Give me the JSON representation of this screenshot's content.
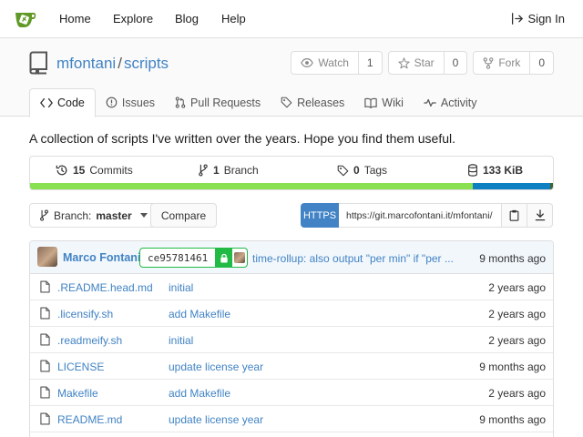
{
  "nav": {
    "items": [
      {
        "label": "Home"
      },
      {
        "label": "Explore"
      },
      {
        "label": "Blog"
      },
      {
        "label": "Help"
      }
    ],
    "signin": "Sign In"
  },
  "repo": {
    "owner": "mfontani",
    "separator": "/",
    "name": "scripts",
    "watch": {
      "label": "Watch",
      "count": "1"
    },
    "star": {
      "label": "Star",
      "count": "0"
    },
    "fork": {
      "label": "Fork",
      "count": "0"
    }
  },
  "tabs": [
    {
      "label": "Code",
      "icon": "code-icon"
    },
    {
      "label": "Issues",
      "icon": "issue-icon"
    },
    {
      "label": "Pull Requests",
      "icon": "pull-request-icon"
    },
    {
      "label": "Releases",
      "icon": "tag-icon"
    },
    {
      "label": "Wiki",
      "icon": "book-icon"
    },
    {
      "label": "Activity",
      "icon": "pulse-icon"
    }
  ],
  "description": "A collection of scripts I've written over the years. Hope you find them useful.",
  "stats": {
    "commits_count": "15",
    "commits_label": "Commits",
    "branches_count": "1",
    "branches_label": "Branch",
    "tags_count": "0",
    "tags_label": "Tags",
    "size": "133 KiB"
  },
  "languages": [
    {
      "share": 0.847,
      "color": "#89e051"
    },
    {
      "share": 0.147,
      "color": "#0e7fc0"
    },
    {
      "share": 0.006,
      "color": "#3e6630"
    }
  ],
  "branch": {
    "prefix": "Branch:",
    "name": "master"
  },
  "compare_label": "Compare",
  "clone": {
    "protocol": "HTTPS",
    "url": "https://git.marcofontani.it/mfontani/"
  },
  "latest_commit": {
    "author": "Marco Fontani",
    "sha": "ce95781461",
    "message": "time-rollup: also output \"per min\" if \"per ...",
    "time": "9 months ago"
  },
  "files": [
    {
      "name": ".README.head.md",
      "message": "initial",
      "time": "2 years ago"
    },
    {
      "name": ".licensify.sh",
      "message": "add Makefile",
      "time": "2 years ago"
    },
    {
      "name": ".readmeify.sh",
      "message": "initial",
      "time": "2 years ago"
    },
    {
      "name": "LICENSE",
      "message": "update license year",
      "time": "9 months ago"
    },
    {
      "name": "Makefile",
      "message": "add Makefile",
      "time": "2 years ago"
    },
    {
      "name": "README.md",
      "message": "update license year",
      "time": "9 months ago"
    }
  ],
  "colors": {
    "accent": "#4183c4",
    "logo": "#609926",
    "signed": "#21ba45"
  }
}
